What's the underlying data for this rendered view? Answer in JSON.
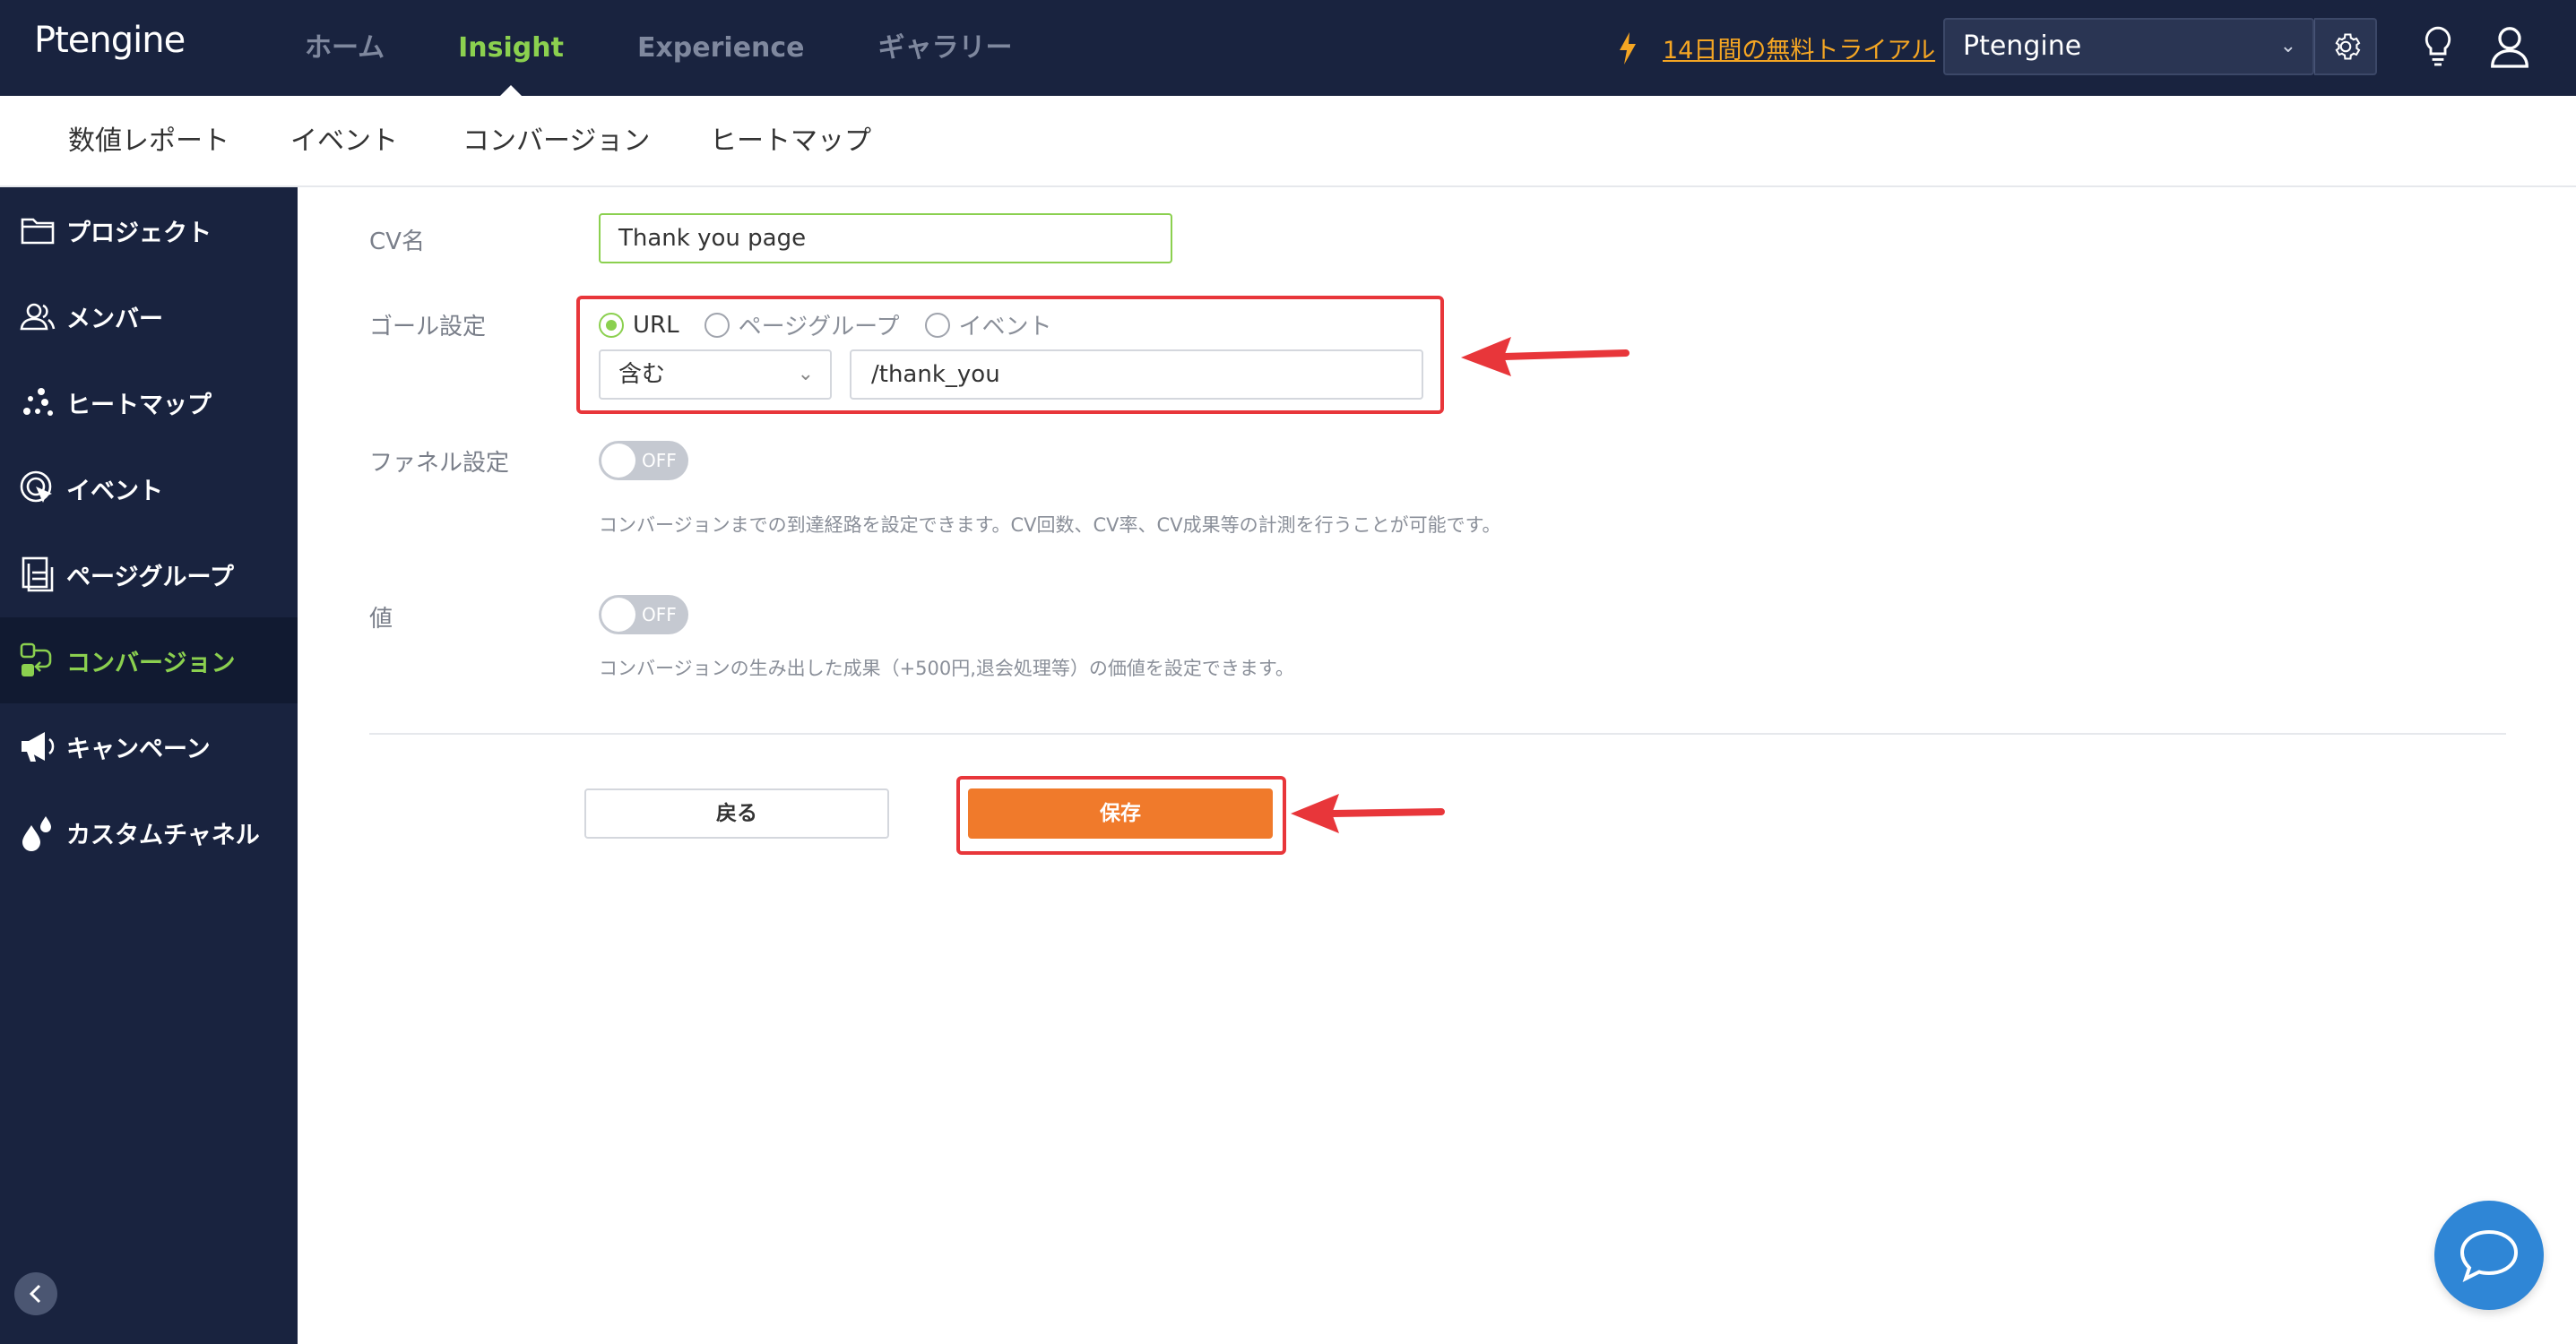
{
  "brand": {
    "logo": "Ptengine"
  },
  "top_nav": [
    {
      "label": "ホーム",
      "active": false
    },
    {
      "label": "Insight",
      "active": true
    },
    {
      "label": "Experience",
      "active": false
    },
    {
      "label": "ギャラリー",
      "active": false
    }
  ],
  "trial": {
    "label": "14日間の無料トライアル"
  },
  "project_select": {
    "value": "Ptengine"
  },
  "sub_nav": [
    "数値レポート",
    "イベント",
    "コンバージョン",
    "ヒートマップ"
  ],
  "sidebar": {
    "items": [
      {
        "label": "プロジェクト",
        "icon": "folder-icon",
        "active": false
      },
      {
        "label": "メンバー",
        "icon": "members-icon",
        "active": false
      },
      {
        "label": "ヒートマップ",
        "icon": "heatmap-icon",
        "active": false
      },
      {
        "label": "イベント",
        "icon": "event-icon",
        "active": false
      },
      {
        "label": "ページグループ",
        "icon": "page-group-icon",
        "active": false
      },
      {
        "label": "コンバージョン",
        "icon": "conversion-icon",
        "active": true
      },
      {
        "label": "キャンペーン",
        "icon": "megaphone-icon",
        "active": false
      },
      {
        "label": "カスタムチャネル",
        "icon": "drops-icon",
        "active": false
      }
    ]
  },
  "form": {
    "cv_name_label": "CV名",
    "cv_name_value": "Thank you page",
    "goal_label": "ゴール設定",
    "goal_options": [
      {
        "label": "URL",
        "checked": true
      },
      {
        "label": "ページグループ",
        "checked": false
      },
      {
        "label": "イベント",
        "checked": false
      }
    ],
    "match_type": "含む",
    "url_value": "/thank_you",
    "funnel_label": "ファネル設定",
    "funnel_toggle": "OFF",
    "funnel_help": "コンバージョンまでの到達経路を設定できます。CV回数、CV率、CV成果等の計測を行うことが可能です。",
    "value_label": "値",
    "value_toggle": "OFF",
    "value_help": "コンバージョンの生み出した成果（+500円,退会処理等）の価値を設定できます。",
    "back_label": "戻る",
    "save_label": "保存"
  },
  "colors": {
    "nav_bg": "#19233f",
    "accent_green": "#8bd04f",
    "save_orange": "#f07a2b",
    "annotation_red": "#e8363a",
    "chat_blue": "#2f86d6"
  }
}
